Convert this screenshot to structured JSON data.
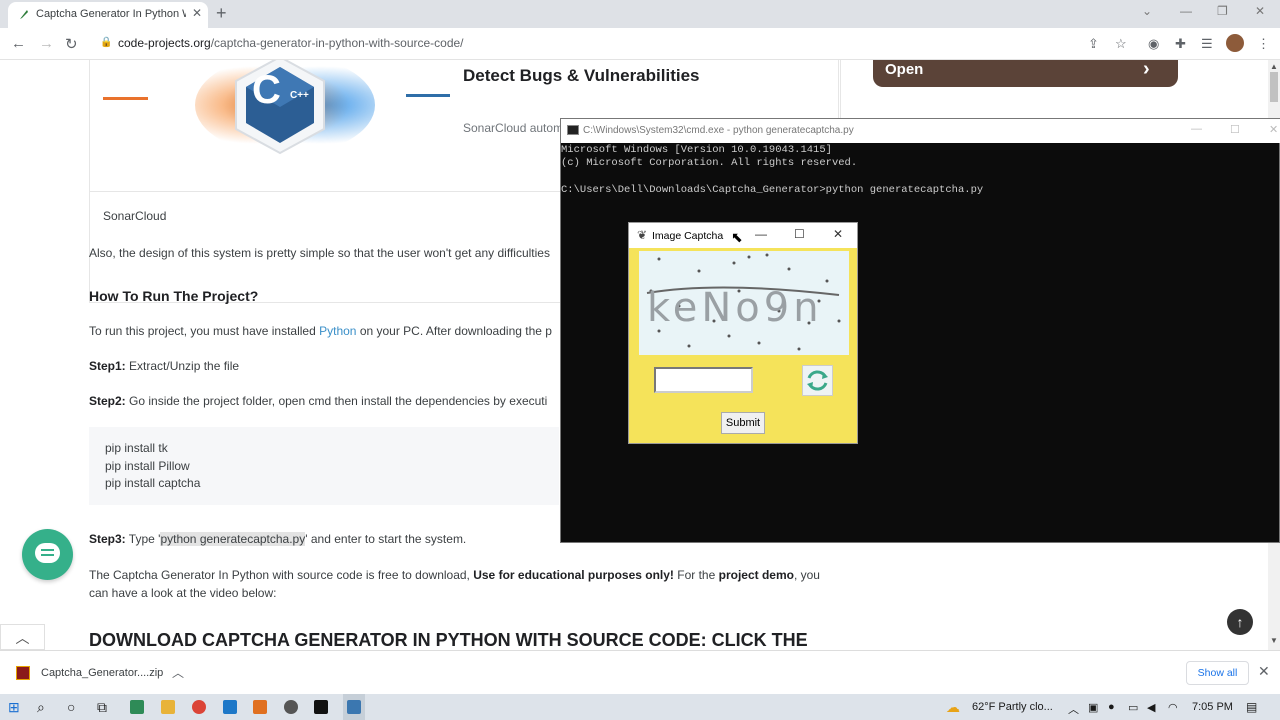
{
  "browser": {
    "tab_title": "Captcha Generator In Python Wi",
    "new_tab": "+",
    "url_domain": "code-projects.org",
    "url_path": "/captcha-generator-in-python-with-source-code/"
  },
  "ad": {
    "title": "Detect Bugs & Vulnerabilities",
    "subtitle": "SonarCloud autom",
    "brand": "SonarCloud",
    "logo_text": "C++",
    "open_label": "Open"
  },
  "article": {
    "para_design": "Also, the design of this system is pretty simple so that the user won't get any difficulties",
    "heading_run": "How To Run The Project?",
    "para_install_a": "To run this project, you must have installed ",
    "para_install_link": "Python",
    "para_install_b": " on your PC. After downloading the p",
    "step1_label": "Step1:",
    "step1_text": " Extract/Unzip the file",
    "step2_label": "Step2:",
    "step2_text": " Go inside the project folder, open cmd then install the dependencies by executi",
    "code_lines": [
      "pip install tk",
      "pip install Pillow",
      "pip install captcha"
    ],
    "step3_label": "Step3:",
    "step3_a": " Type '",
    "step3_highlight": "python generatecaptcha.py",
    "step3_b": "' and enter to start the system.",
    "para_free_a": "The Captcha Generator In Python with source code is free to download, ",
    "para_free_bold1": "Use for educational purposes only!",
    "para_free_b": " For the ",
    "para_free_bold2": "project demo",
    "para_free_c": ", you",
    "para_free_line2": "can have a look at the video below:",
    "download_heading": "DOWNLOAD CAPTCHA GENERATOR IN PYTHON WITH SOURCE CODE: CLICK THE"
  },
  "cmd": {
    "title": "C:\\Windows\\System32\\cmd.exe - python  generatecaptcha.py",
    "lines": [
      "Microsoft Windows [Version 10.0.19043.1415]",
      "(c) Microsoft Corporation. All rights reserved.",
      "",
      "C:\\Users\\Dell\\Downloads\\Captcha_Generator>python generatecaptcha.py"
    ]
  },
  "captcha": {
    "title": "Image Captcha",
    "captcha_text": "keNo9n",
    "entry_value": "",
    "submit_label": "Submit"
  },
  "downloads": {
    "file_name": "Captcha_Generator....zip",
    "show_all": "Show all"
  },
  "taskbar": {
    "weather": "62°F  Partly clo...",
    "time": "7:05 PM"
  },
  "colors": {
    "captcha_bg": "#f5e35a",
    "open_btn": "#5b4338",
    "chat_btn": "#35b08a",
    "link": "#3a8fc8"
  }
}
